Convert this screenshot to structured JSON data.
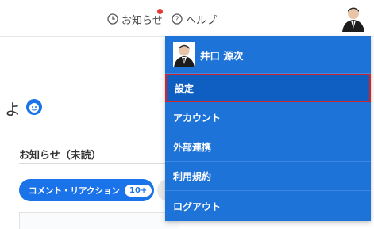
{
  "header": {
    "notice_label": "お知らせ",
    "help_label": "ヘルプ"
  },
  "page": {
    "heading_fragment": "よ",
    "section_title": "お知らせ（未読）",
    "filter_pill_label": "コメント・リアクション",
    "filter_pill_badge": "10+"
  },
  "dropdown": {
    "username": "井口 源次",
    "items": [
      {
        "label": "設定",
        "selected": true
      },
      {
        "label": "アカウント"
      },
      {
        "label": "外部連携"
      },
      {
        "label": "利用規約"
      },
      {
        "label": "ログアウト"
      }
    ]
  },
  "colors": {
    "accent": "#1d73d8",
    "selection_border": "#d0262b",
    "notification_dot": "#e53935"
  }
}
